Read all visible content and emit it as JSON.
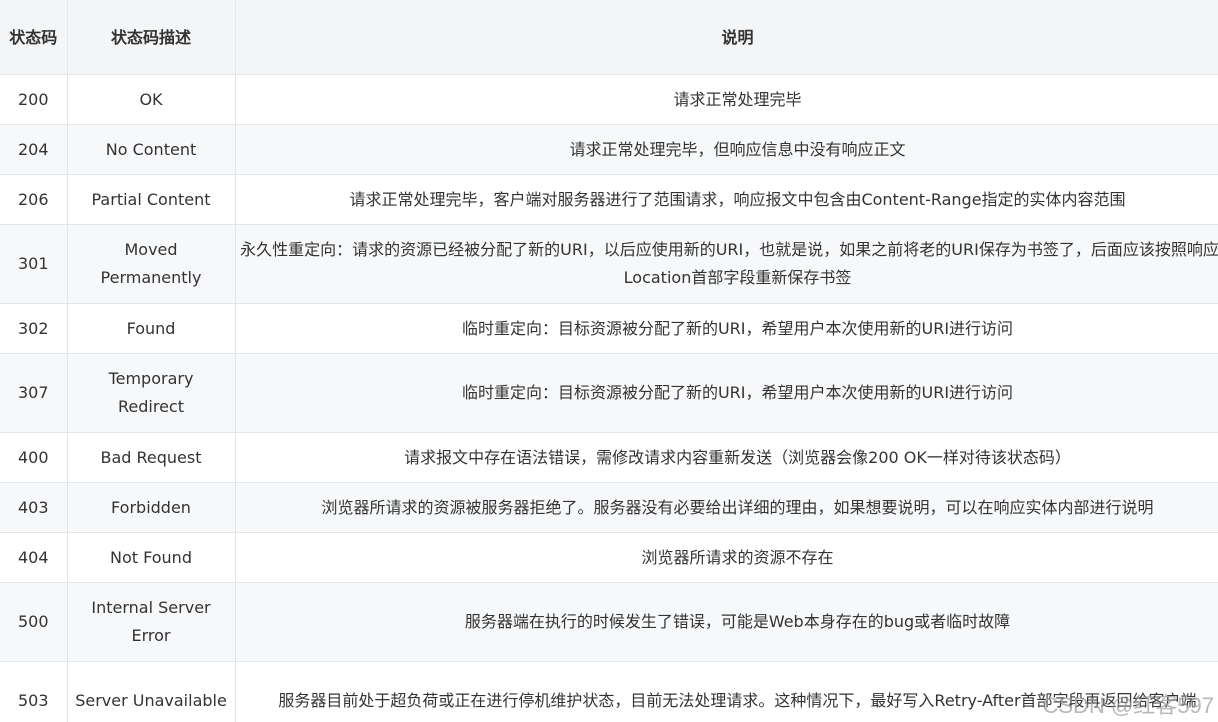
{
  "table": {
    "headers": {
      "code": "状态码",
      "desc": "状态码描述",
      "note": "说明"
    },
    "rows": [
      {
        "code": "200",
        "desc": "OK",
        "note": "请求正常处理完毕"
      },
      {
        "code": "204",
        "desc": "No Content",
        "note": "请求正常处理完毕，但响应信息中没有响应正文"
      },
      {
        "code": "206",
        "desc": "Partial Content",
        "note": "请求正常处理完毕，客户端对服务器进行了范围请求，响应报文中包含由Content-Range指定的实体内容范围"
      },
      {
        "code": "301",
        "desc": "Moved Permanently",
        "note": "永久性重定向：请求的资源已经被分配了新的URI，以后应使用新的URI，也就是说，如果之前将老的URI保存为书签了，后面应该按照响应的Location首部字段重新保存书签"
      },
      {
        "code": "302",
        "desc": "Found",
        "note": "临时重定向：目标资源被分配了新的URI，希望用户本次使用新的URI进行访问"
      },
      {
        "code": "307",
        "desc": "Temporary Redirect",
        "note": "临时重定向：目标资源被分配了新的URI，希望用户本次使用新的URI进行访问"
      },
      {
        "code": "400",
        "desc": "Bad Request",
        "note": "请求报文中存在语法错误，需修改请求内容重新发送（浏览器会像200 OK一样对待该状态码）"
      },
      {
        "code": "403",
        "desc": "Forbidden",
        "note": "浏览器所请求的资源被服务器拒绝了。服务器没有必要给出详细的理由，如果想要说明，可以在响应实体内部进行说明"
      },
      {
        "code": "404",
        "desc": "Not Found",
        "note": "浏览器所请求的资源不存在"
      },
      {
        "code": "500",
        "desc": "Internal Server Error",
        "note": "服务器端在执行的时候发生了错误，可能是Web本身存在的bug或者临时故障"
      },
      {
        "code": "503",
        "desc": "Server Unavailable",
        "note": "服务器目前处于超负荷或正在进行停机维护状态，目前无法处理请求。这种情况下，最好写入Retry-After首部字段再返回给客户端"
      }
    ]
  },
  "watermark": "CSDN @红客597"
}
